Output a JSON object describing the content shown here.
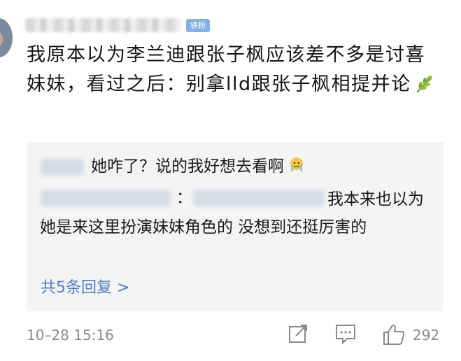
{
  "comment": {
    "badge": "铁粉",
    "text": "我原本以为李兰迪跟张子枫应该差不多是讨喜妹妹，看过之后：别拿lld跟张子枫相提并论",
    "emoji": "leaf-icon"
  },
  "replies": {
    "reply1_text": "她咋了？说的我好想去看啊",
    "reply1_emoji": "crying-face-icon",
    "reply2_colon": "：",
    "reply2_text": "我本来也以为她是来这里扮演妹妹角色的 没想到还挺厉害的",
    "more_label": "共5条回复 >"
  },
  "footer": {
    "timestamp": "10–28 15:16",
    "like_count": "292"
  },
  "colors": {
    "link": "#4a7fbf",
    "badge": "#84b0e4",
    "reply_bg": "#f4f4f4",
    "meta": "#8a8a8a"
  }
}
